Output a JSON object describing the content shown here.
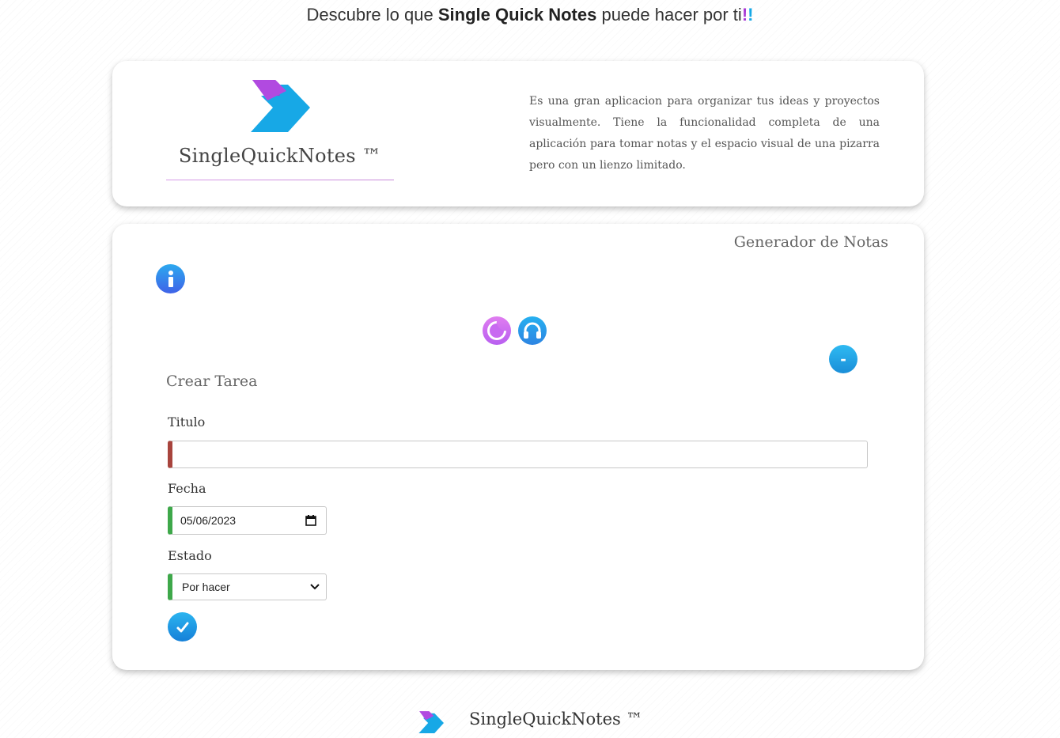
{
  "header": {
    "prefix": "Descubre lo que ",
    "brand": "Single Quick Notes",
    "suffix": " puede hacer por ti",
    "excl1": "!",
    "excl2": "!"
  },
  "intro": {
    "logo_text": "SingleQuickNotes ™",
    "description": "Es una gran aplicacion para organizar tus ideas y proyectos visualmente. Tiene la funcionalidad completa de una aplicación para tomar notas y el espacio visual de una pizarra pero con un lienzo limitado."
  },
  "generator": {
    "title": "Generador de Notas",
    "collapse_label": "-",
    "form_title": "Crear Tarea",
    "titulo_label": "Titulo",
    "titulo_value": "",
    "fecha_label": "Fecha",
    "fecha_value": "05/06/2023",
    "estado_label": "Estado",
    "estado_value": "Por hacer"
  },
  "footer": {
    "logo_text": "SingleQuickNotes ™"
  },
  "icons": {
    "info": "info-icon",
    "theme": "moon-icon",
    "audio": "headphones-icon",
    "submit": "checkmark-icon",
    "calendar": "calendar-icon",
    "dropdown": "chevron-down-icon"
  },
  "colors": {
    "brand_purple": "#a93bd6",
    "brand_blue": "#17a8e6",
    "titulo_border": "#a8443d",
    "valid_border": "#3ea84a"
  }
}
